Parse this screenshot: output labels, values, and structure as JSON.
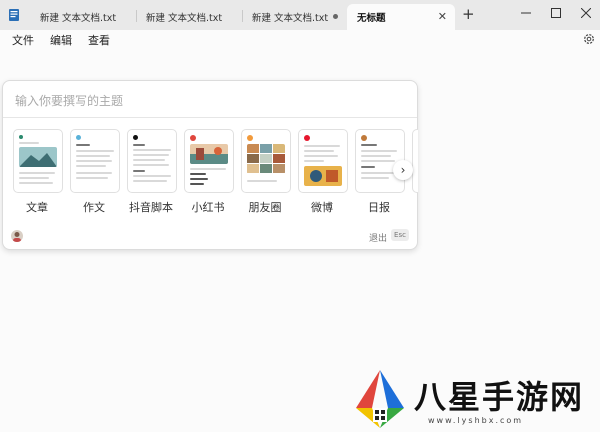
{
  "tabs": [
    {
      "label": "新建 文本文档.txt",
      "active": false,
      "modified": false
    },
    {
      "label": "新建 文本文档.txt",
      "active": false,
      "modified": false
    },
    {
      "label": "新建 文本文档.txt",
      "active": false,
      "modified": true
    },
    {
      "label": "无标题",
      "active": true,
      "modified": false
    }
  ],
  "menu": {
    "file": "文件",
    "edit": "编辑",
    "view": "查看"
  },
  "prompt": {
    "placeholder": "输入你要撰写的主题"
  },
  "templates": [
    {
      "label": "文章"
    },
    {
      "label": "作文"
    },
    {
      "label": "抖音脚本"
    },
    {
      "label": "小红书"
    },
    {
      "label": "朋友圈"
    },
    {
      "label": "微博"
    },
    {
      "label": "日报"
    }
  ],
  "footer": {
    "exit": "退出",
    "esc": "Esc"
  },
  "watermark": {
    "text": "八星手游网",
    "url": "www.lyshbx.com"
  },
  "colors": {
    "accent": "#2b8a6e",
    "red": "#e0463d",
    "yellow": "#f2c300",
    "green": "#38a842",
    "blue": "#1e6fd9"
  }
}
